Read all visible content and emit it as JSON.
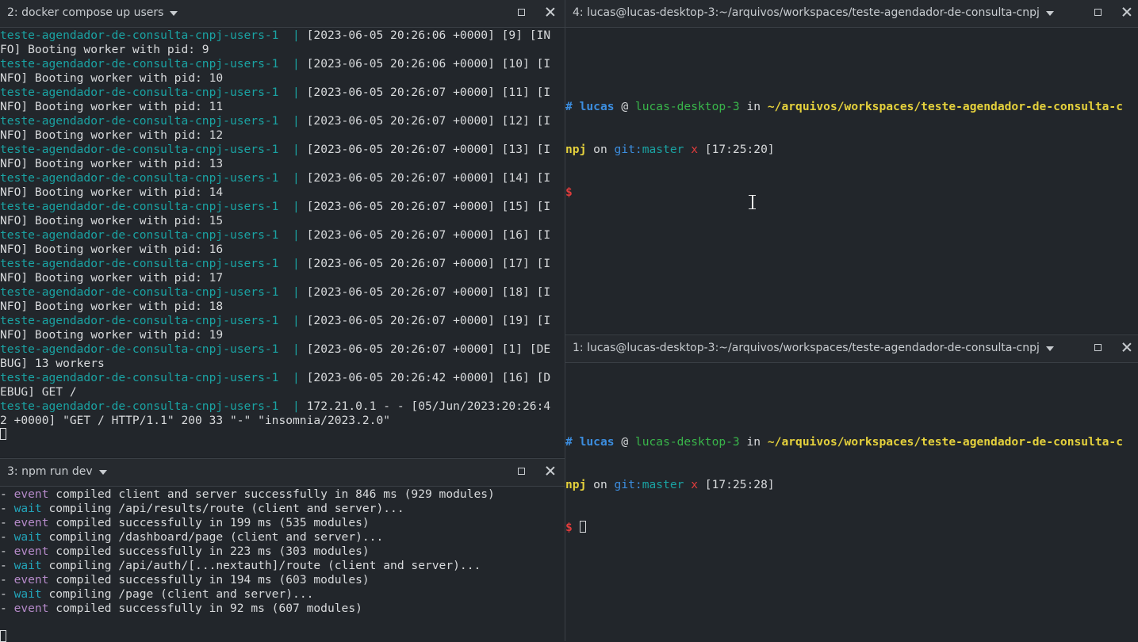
{
  "panes": {
    "docker": {
      "title": "2: docker compose up users",
      "lines": [
        {
          "svc": "teste-agendador-de-consulta-cnpj-users-1",
          "pipe": "|",
          "text": "[2023-06-05 20:26:06 +0000] [9] [IN"
        },
        {
          "svc": "",
          "pipe": "",
          "text": "FO] Booting worker with pid: 9"
        },
        {
          "svc": "teste-agendador-de-consulta-cnpj-users-1",
          "pipe": "|",
          "text": "[2023-06-05 20:26:06 +0000] [10] [I"
        },
        {
          "svc": "",
          "pipe": "",
          "text": "NFO] Booting worker with pid: 10"
        },
        {
          "svc": "teste-agendador-de-consulta-cnpj-users-1",
          "pipe": "|",
          "text": "[2023-06-05 20:26:07 +0000] [11] [I"
        },
        {
          "svc": "",
          "pipe": "",
          "text": "NFO] Booting worker with pid: 11"
        },
        {
          "svc": "teste-agendador-de-consulta-cnpj-users-1",
          "pipe": "|",
          "text": "[2023-06-05 20:26:07 +0000] [12] [I"
        },
        {
          "svc": "",
          "pipe": "",
          "text": "NFO] Booting worker with pid: 12"
        },
        {
          "svc": "teste-agendador-de-consulta-cnpj-users-1",
          "pipe": "|",
          "text": "[2023-06-05 20:26:07 +0000] [13] [I"
        },
        {
          "svc": "",
          "pipe": "",
          "text": "NFO] Booting worker with pid: 13"
        },
        {
          "svc": "teste-agendador-de-consulta-cnpj-users-1",
          "pipe": "|",
          "text": "[2023-06-05 20:26:07 +0000] [14] [I"
        },
        {
          "svc": "",
          "pipe": "",
          "text": "NFO] Booting worker with pid: 14"
        },
        {
          "svc": "teste-agendador-de-consulta-cnpj-users-1",
          "pipe": "|",
          "text": "[2023-06-05 20:26:07 +0000] [15] [I"
        },
        {
          "svc": "",
          "pipe": "",
          "text": "NFO] Booting worker with pid: 15"
        },
        {
          "svc": "teste-agendador-de-consulta-cnpj-users-1",
          "pipe": "|",
          "text": "[2023-06-05 20:26:07 +0000] [16] [I"
        },
        {
          "svc": "",
          "pipe": "",
          "text": "NFO] Booting worker with pid: 16"
        },
        {
          "svc": "teste-agendador-de-consulta-cnpj-users-1",
          "pipe": "|",
          "text": "[2023-06-05 20:26:07 +0000] [17] [I"
        },
        {
          "svc": "",
          "pipe": "",
          "text": "NFO] Booting worker with pid: 17"
        },
        {
          "svc": "teste-agendador-de-consulta-cnpj-users-1",
          "pipe": "|",
          "text": "[2023-06-05 20:26:07 +0000] [18] [I"
        },
        {
          "svc": "",
          "pipe": "",
          "text": "NFO] Booting worker with pid: 18"
        },
        {
          "svc": "teste-agendador-de-consulta-cnpj-users-1",
          "pipe": "|",
          "text": "[2023-06-05 20:26:07 +0000] [19] [I"
        },
        {
          "svc": "",
          "pipe": "",
          "text": "NFO] Booting worker with pid: 19"
        },
        {
          "svc": "teste-agendador-de-consulta-cnpj-users-1",
          "pipe": "|",
          "text": "[2023-06-05 20:26:07 +0000] [1] [DE"
        },
        {
          "svc": "",
          "pipe": "",
          "text": "BUG] 13 workers"
        },
        {
          "svc": "teste-agendador-de-consulta-cnpj-users-1",
          "pipe": "|",
          "text": "[2023-06-05 20:26:42 +0000] [16] [D"
        },
        {
          "svc": "",
          "pipe": "",
          "text": "EBUG] GET /"
        },
        {
          "svc": "teste-agendador-de-consulta-cnpj-users-1",
          "pipe": "|",
          "text": "172.21.0.1 - - [05/Jun/2023:20:26:4"
        },
        {
          "svc": "",
          "pipe": "",
          "text": "2 +0000] \"GET / HTTP/1.1\" 200 33 \"-\" \"insomnia/2023.2.0\""
        }
      ]
    },
    "npm": {
      "title": "3: npm run dev",
      "lines": [
        {
          "dash": "- ",
          "kw": "event",
          "text": " compiled client and server successfully in 846 ms (929 modules)"
        },
        {
          "dash": "- ",
          "kw": "wait",
          "text": " compiling /api/results/route (client and server)..."
        },
        {
          "dash": "- ",
          "kw": "event",
          "text": " compiled successfully in 199 ms (535 modules)"
        },
        {
          "dash": "- ",
          "kw": "wait",
          "text": " compiling /dashboard/page (client and server)..."
        },
        {
          "dash": "- ",
          "kw": "event",
          "text": " compiled successfully in 223 ms (303 modules)"
        },
        {
          "dash": "- ",
          "kw": "wait",
          "text": " compiling /api/auth/[...nextauth]/route (client and server)..."
        },
        {
          "dash": "- ",
          "kw": "event",
          "text": " compiled successfully in 194 ms (603 modules)"
        },
        {
          "dash": "- ",
          "kw": "wait",
          "text": " compiling /page (client and server)..."
        },
        {
          "dash": "- ",
          "kw": "event",
          "text": " compiled successfully in 92 ms (607 modules)"
        }
      ]
    },
    "shell4": {
      "title": "4: lucas@lucas-desktop-3:~/arquivos/workspaces/teste-agendador-de-consulta-cnpj",
      "prompt": {
        "hash": "#",
        "user": "lucas",
        "at": "@",
        "host": "lucas-desktop-3",
        "in": "in",
        "path1": "~/arquivos/workspaces/teste-agendador-de-consulta-c",
        "path2": "npj",
        "on": "on",
        "git": "git:",
        "branch": "master",
        "x": "x",
        "time": "[17:25:20]",
        "dollar": "$"
      }
    },
    "shell1": {
      "title": "1: lucas@lucas-desktop-3:~/arquivos/workspaces/teste-agendador-de-consulta-cnpj",
      "prompt": {
        "hash": "#",
        "user": "lucas",
        "at": "@",
        "host": "lucas-desktop-3",
        "in": "in",
        "path1": "~/arquivos/workspaces/teste-agendador-de-consulta-c",
        "path2": "npj",
        "on": "on",
        "git": "git:",
        "branch": "master",
        "x": "x",
        "time": "[17:25:28]",
        "dollar": "$"
      }
    }
  },
  "icons": {
    "maximize": "maximize-icon",
    "close": "close-icon",
    "dropdown": "chevron-down-icon"
  },
  "colors": {
    "background": "#22262b",
    "header": "#262a2f",
    "service": "#1aa3a3",
    "event": "#b58ac9",
    "wait": "#22a3b8",
    "path": "#e5d13c",
    "host": "#39b54a",
    "error": "#e03c3c",
    "user": "#3c8ee0"
  }
}
